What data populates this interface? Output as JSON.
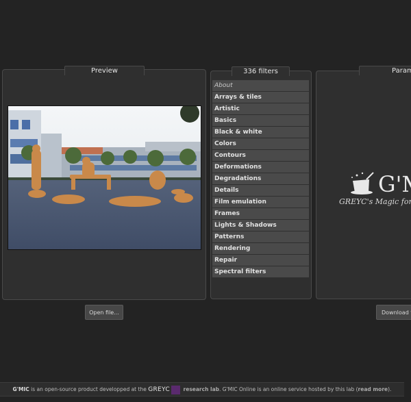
{
  "preview": {
    "tab_label": "Preview"
  },
  "filters": {
    "tab_label": "336 filters",
    "items": [
      "About",
      "Arrays & tiles",
      "Artistic",
      "Basics",
      "Black & white",
      "Colors",
      "Contours",
      "Deformations",
      "Degradations",
      "Details",
      "Film emulation",
      "Frames",
      "Lights & Shadows",
      "Patterns",
      "Rendering",
      "Repair",
      "Spectral filters"
    ]
  },
  "params": {
    "tab_label": "Param",
    "logo_title": "G'M",
    "logo_subtitle": "GREYC's Magic for"
  },
  "buttons": {
    "open_file": "Open file...",
    "download": "Download f"
  },
  "footer": {
    "brand": "G'MIC",
    "text1": " is an open-source product developped at the ",
    "greyc": "GREYC",
    "research_lab": " research lab",
    "text2": ". G'MIC Online is an online service hosted by this lab (",
    "read_more": "read more",
    "text3": ")."
  },
  "colors": {
    "background": "#232323",
    "panel": "#2f2f2f",
    "list_item": "#4a4a4a",
    "greyc_mark": "#5a2a6e"
  }
}
